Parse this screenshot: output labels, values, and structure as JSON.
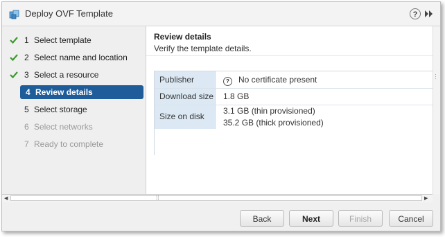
{
  "window": {
    "title": "Deploy OVF Template",
    "help_glyph": "?",
    "icons": [
      "ovf-template-icon",
      "help-icon",
      "expand-icon"
    ]
  },
  "steps": [
    {
      "num": "1",
      "label": "Select template",
      "state": "done"
    },
    {
      "num": "2",
      "label": "Select name and location",
      "state": "done"
    },
    {
      "num": "3",
      "label": "Select a resource",
      "state": "done"
    },
    {
      "num": "4",
      "label": "Review details",
      "state": "active"
    },
    {
      "num": "5",
      "label": "Select storage",
      "state": "pending"
    },
    {
      "num": "6",
      "label": "Select networks",
      "state": "disabled"
    },
    {
      "num": "7",
      "label": "Ready to complete",
      "state": "disabled"
    }
  ],
  "main": {
    "title": "Review details",
    "subtitle": "Verify the template details.",
    "details": [
      {
        "key": "Publisher",
        "values": [
          "No certificate present"
        ],
        "icon": "question-icon"
      },
      {
        "key": "Download size",
        "values": [
          "1.8 GB"
        ]
      },
      {
        "key": "Size on disk",
        "values": [
          "3.1 GB (thin provisioned)",
          "35.2 GB (thick provisioned)"
        ]
      }
    ]
  },
  "footer": {
    "back_label": "Back",
    "next_label": "Next",
    "finish_label": "Finish",
    "cancel_label": "Cancel"
  },
  "colors": {
    "active_step_bg": "#1e5d9a",
    "check_green": "#3a9a2c",
    "detail_key_bg": "#dce9f4"
  }
}
